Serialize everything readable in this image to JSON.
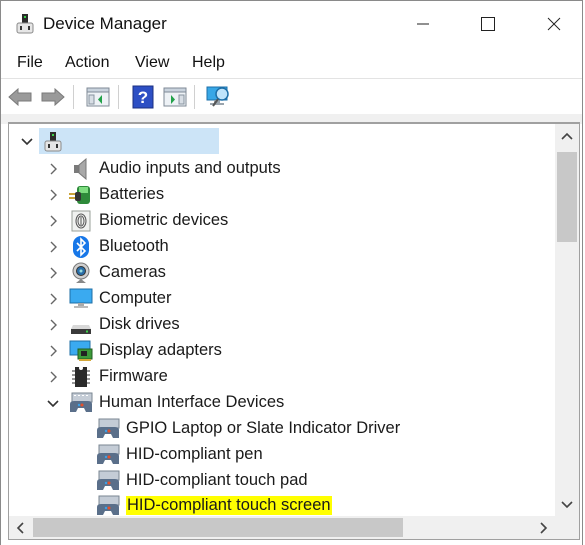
{
  "window": {
    "title": "Device Manager",
    "controls": {
      "minimize": "minimize",
      "maximize": "maximize",
      "close": "close"
    }
  },
  "menu": {
    "items": [
      {
        "label": "File"
      },
      {
        "label": "Action"
      },
      {
        "label": "View"
      },
      {
        "label": "Help"
      }
    ]
  },
  "toolbar": {
    "buttons": [
      {
        "icon": "back-arrow-icon"
      },
      {
        "icon": "forward-arrow-icon"
      },
      {
        "icon": "show-hide-console-tree-icon"
      },
      {
        "icon": "help-icon"
      },
      {
        "icon": "show-hide-action-pane-icon"
      },
      {
        "icon": "scan-hardware-icon"
      }
    ]
  },
  "tree": {
    "root": {
      "label": "",
      "expanded": true,
      "selected": true
    },
    "categories": [
      {
        "label": "Audio inputs and outputs",
        "icon": "speaker-icon",
        "expanded": false
      },
      {
        "label": "Batteries",
        "icon": "battery-icon",
        "expanded": false
      },
      {
        "label": "Biometric devices",
        "icon": "fingerprint-icon",
        "expanded": false
      },
      {
        "label": "Bluetooth",
        "icon": "bluetooth-icon",
        "expanded": false
      },
      {
        "label": "Cameras",
        "icon": "webcam-icon",
        "expanded": false
      },
      {
        "label": "Computer",
        "icon": "monitor-icon",
        "expanded": false
      },
      {
        "label": "Disk drives",
        "icon": "disk-drive-icon",
        "expanded": false
      },
      {
        "label": "Display adapters",
        "icon": "display-adapter-icon",
        "expanded": false
      },
      {
        "label": "Firmware",
        "icon": "chip-icon",
        "expanded": false
      },
      {
        "label": "Human Interface Devices",
        "icon": "hid-icon",
        "expanded": true,
        "children": [
          {
            "label": "GPIO Laptop or Slate Indicator Driver",
            "highlighted": false
          },
          {
            "label": "HID-compliant pen",
            "highlighted": false
          },
          {
            "label": "HID-compliant touch pad",
            "highlighted": false
          },
          {
            "label": "HID-compliant touch screen",
            "highlighted": true
          }
        ]
      }
    ]
  },
  "colors": {
    "selection": "#cce4f7",
    "highlight": "#ffff00",
    "scroll_thumb": "#c8c8c8"
  }
}
